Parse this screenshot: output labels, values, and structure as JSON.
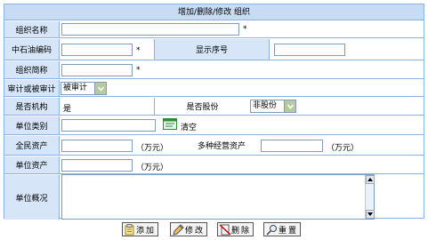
{
  "title": "增加/删除/修改 组织",
  "required_mark": "*",
  "fields": {
    "org_name": {
      "label": "组织名称",
      "value": ""
    },
    "petro_code": {
      "label": "中石油编码",
      "value": ""
    },
    "display_order": {
      "label": "显示序号",
      "value": ""
    },
    "org_short": {
      "label": "组织简称",
      "value": ""
    },
    "audit": {
      "label": "审计或被审计",
      "selected": "被审计"
    },
    "is_org": {
      "label": "是否机构",
      "value": "是"
    },
    "is_share": {
      "label": "是否股份",
      "selected": "非股份"
    },
    "unit_type": {
      "label": "单位类别",
      "value": "",
      "clear_label": "清空"
    },
    "public_assets": {
      "label": "全民资产",
      "value": "",
      "unit": "（万元）"
    },
    "diverse_assets": {
      "label": "多种经营资产",
      "value": "",
      "unit": "（万元）"
    },
    "unit_assets": {
      "label": "单位资产",
      "value": "",
      "unit": "（万元）"
    },
    "unit_status": {
      "label": "单位概况",
      "value": ""
    }
  },
  "buttons": {
    "add": "添加",
    "edit": "修改",
    "delete": "删除",
    "reset": "重置"
  }
}
